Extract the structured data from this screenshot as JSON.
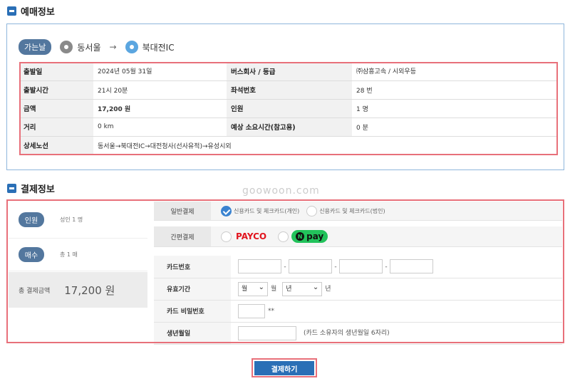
{
  "reservation": {
    "title": "예매정보",
    "route": {
      "departure_label": "가는날",
      "from": "동서울",
      "arrow": "→",
      "to": "북대전IC"
    },
    "rows": [
      {
        "l1": "출발일",
        "v1": "2024년 05월 31일",
        "l2": "버스회사 / 등급",
        "v2": "㈜삼흥고속 / 시외우등"
      },
      {
        "l1": "출발시간",
        "v1": "21시 20분",
        "l2": "좌석번호",
        "v2": "28 번"
      },
      {
        "l1": "금액",
        "v1": "17,200 원",
        "l2": "인원",
        "v2": "1 명"
      },
      {
        "l1": "거리",
        "v1": "0 km",
        "l2": "예상 소요시간(참고용)",
        "v2": "0 분"
      }
    ],
    "route_detail": {
      "label": "상세노선",
      "value": "동서울→북대전IC→대전청사(선사유적)→유성시외"
    }
  },
  "payment": {
    "title": "결제정보",
    "watermark": "goowoon.com",
    "summary": {
      "people_label": "인원",
      "people_value": "성인 1 명",
      "count_label": "매수",
      "count_value": "총 1 매",
      "total_label": "총 결제금액",
      "total_value": "17,200 원"
    },
    "general": {
      "label": "일반결제",
      "opt1": "신용카드 및 체크카드(개인)",
      "opt2": "신용카드 및 체크카드(법인)"
    },
    "easy": {
      "label": "간편결제",
      "payco": "PAYCO",
      "npay_n": "N",
      "npay": "pay"
    },
    "card_number_label": "카드번호",
    "expiry": {
      "label": "유효기간",
      "month": "월",
      "month_unit": "월",
      "year": "년",
      "year_unit": "년"
    },
    "password": {
      "label": "카드 비밀번호",
      "mask": "**"
    },
    "birth": {
      "label": "생년월일",
      "hint": "(카드 소유자의 생년월일 6자리)"
    },
    "submit": "결제하기"
  }
}
